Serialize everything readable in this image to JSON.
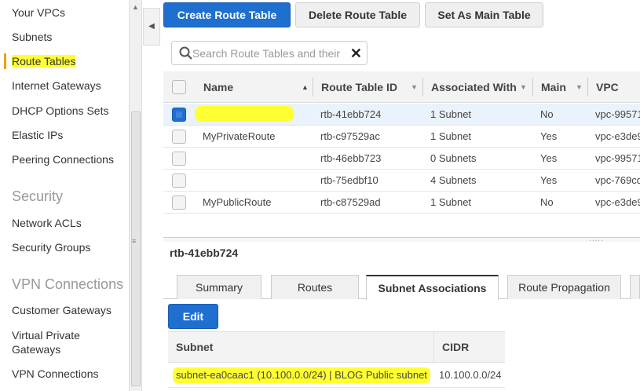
{
  "sidebar": {
    "items": [
      {
        "label": "Your VPCs"
      },
      {
        "label": "Subnets"
      },
      {
        "label": "Route Tables",
        "active": true
      },
      {
        "label": "Internet Gateways"
      },
      {
        "label": "DHCP Options Sets"
      },
      {
        "label": "Elastic IPs"
      },
      {
        "label": "Peering Connections"
      }
    ],
    "security_heading": "Security",
    "security_items": [
      {
        "label": "Network ACLs"
      },
      {
        "label": "Security Groups"
      }
    ],
    "vpn_heading": "VPN Connections",
    "vpn_items": [
      {
        "label": "Customer Gateways"
      },
      {
        "label": "Virtual Private Gateways"
      },
      {
        "label": "VPN Connections"
      }
    ]
  },
  "toolbar": {
    "create_label": "Create Route Table",
    "delete_label": "Delete Route Table",
    "set_main_label": "Set As Main Table"
  },
  "search": {
    "placeholder": "Search Route Tables and their"
  },
  "table": {
    "columns": {
      "name": "Name",
      "id": "Route Table ID",
      "assoc": "Associated With",
      "main": "Main",
      "vpc": "VPC"
    },
    "rows": [
      {
        "name": "",
        "id": "rtb-41ebb724",
        "assoc": "1 Subnet",
        "main": "No",
        "vpc": "vpc-99571",
        "selected": true
      },
      {
        "name": "MyPrivateRoute",
        "id": "rtb-c97529ac",
        "assoc": "1 Subnet",
        "main": "Yes",
        "vpc": "vpc-e3de9",
        "selected": false
      },
      {
        "name": "",
        "id": "rtb-46ebb723",
        "assoc": "0 Subnets",
        "main": "Yes",
        "vpc": "vpc-99571",
        "selected": false
      },
      {
        "name": "",
        "id": "rtb-75edbf10",
        "assoc": "4 Subnets",
        "main": "Yes",
        "vpc": "vpc-769cd",
        "selected": false
      },
      {
        "name": "MyPublicRoute",
        "id": "rtb-c87529ad",
        "assoc": "1 Subnet",
        "main": "No",
        "vpc": "vpc-e3de9",
        "selected": false
      }
    ]
  },
  "detail": {
    "selected_id": "rtb-41ebb724",
    "tabs": [
      {
        "label": "Summary"
      },
      {
        "label": "Routes"
      },
      {
        "label": "Subnet Associations",
        "active": true
      },
      {
        "label": "Route Propagation"
      }
    ],
    "edit_label": "Edit",
    "subnet_table": {
      "col_subnet": "Subnet",
      "col_cidr": "CIDR",
      "rows": [
        {
          "subnet": "subnet-ea0caac1 (10.100.0.0/24) | BLOG Public subnet",
          "cidr": "10.100.0.0/24"
        }
      ]
    }
  },
  "colors": {
    "primary": "#1f6fd0",
    "highlight": "#ffff33",
    "active_marker": "#f0a000"
  }
}
